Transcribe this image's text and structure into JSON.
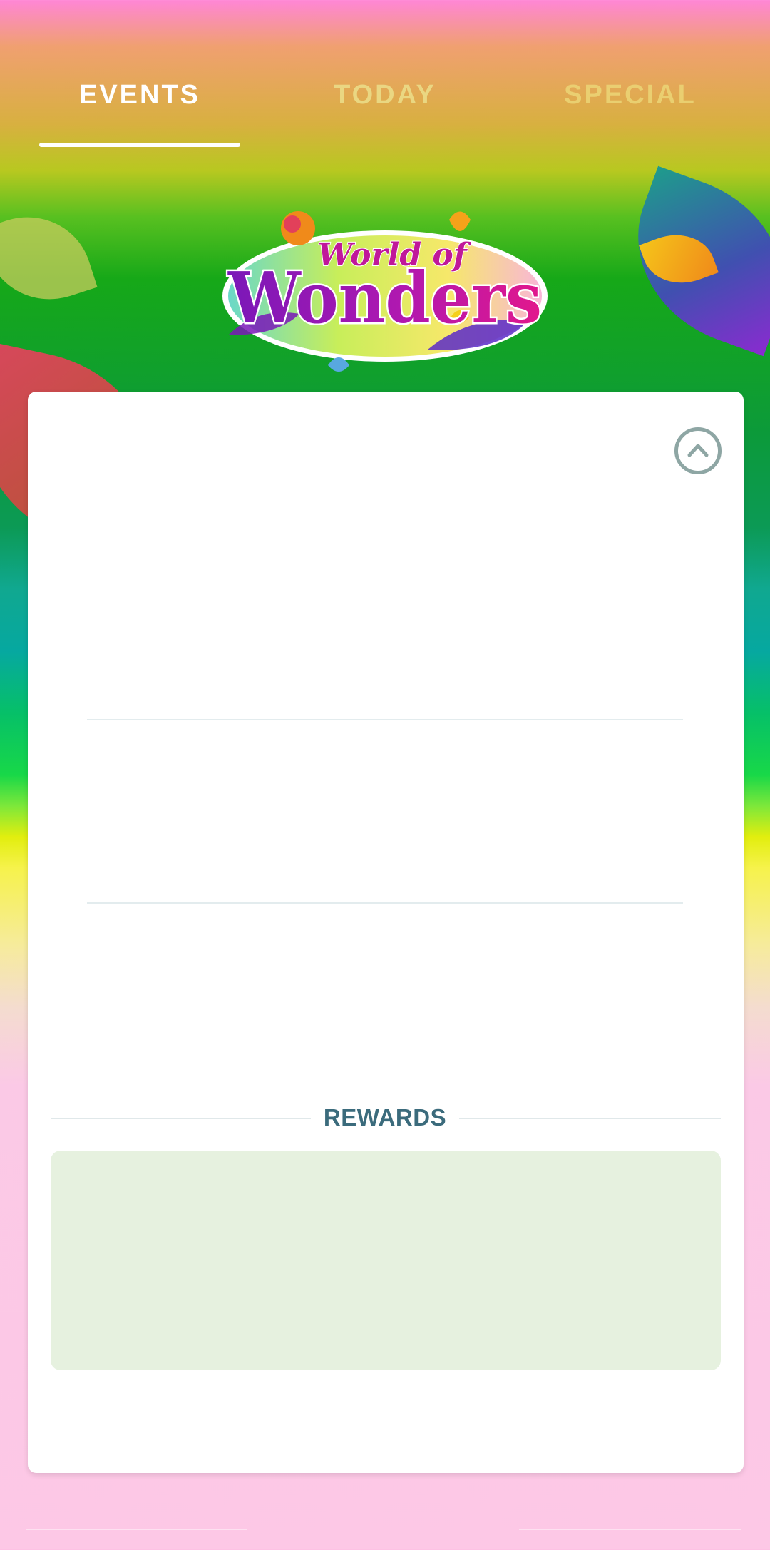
{
  "tabs": [
    {
      "label": "EVENTS",
      "active": true
    },
    {
      "label": "TODAY",
      "active": false
    },
    {
      "label": "SPECIAL",
      "active": false
    }
  ],
  "logo": {
    "line1": "World of",
    "line2": "Wonders"
  },
  "rewards": {
    "title": "REWARDS"
  },
  "icons": {
    "collapse": "chevron-up-icon"
  },
  "colors": {
    "accent_text": "#3b6b7c",
    "rewards_panel": "#e6f1df",
    "logo_purple": "#7a18b8",
    "logo_pink": "#e2188c"
  }
}
